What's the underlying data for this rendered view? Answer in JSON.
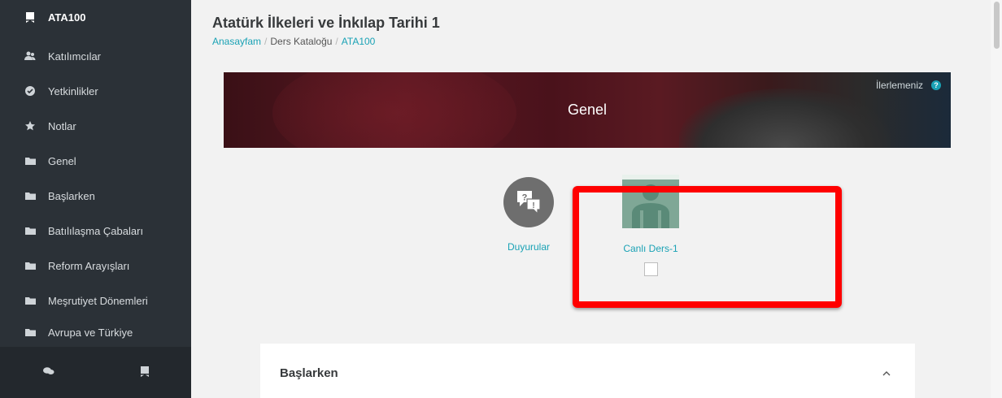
{
  "sidebar": {
    "items": [
      {
        "label": "ATA100",
        "icon": "course-book-icon"
      },
      {
        "label": "Katılımcılar",
        "icon": "users-icon"
      },
      {
        "label": "Yetkinlikler",
        "icon": "check-circle-icon"
      },
      {
        "label": "Notlar",
        "icon": "star-icon"
      },
      {
        "label": "Genel",
        "icon": "folder-icon"
      },
      {
        "label": "Başlarken",
        "icon": "folder-icon"
      },
      {
        "label": "Batılılaşma Çabaları",
        "icon": "folder-icon"
      },
      {
        "label": "Reform Arayışları",
        "icon": "folder-icon"
      },
      {
        "label": "Meşrutiyet Dönemleri",
        "icon": "folder-icon"
      },
      {
        "label": "Avrupa ve Türkiye",
        "icon": "folder-icon"
      }
    ],
    "footer_icons": [
      "chat-icon",
      "course-book-icon"
    ]
  },
  "header": {
    "title": "Atatürk İlkeleri ve İnkılap Tarihi 1",
    "breadcrumb": {
      "home": "Anasayfam",
      "catalog": "Ders Kataloğu",
      "course": "ATA100",
      "separator": "/"
    }
  },
  "banner": {
    "title": "Genel",
    "progress_label": "İlerlemeniz",
    "help_glyph": "?"
  },
  "activities": [
    {
      "label": "Duyurular",
      "icon": "forum-icon"
    },
    {
      "label": "Canlı Ders-1",
      "icon": "live-session-icon",
      "completion_checked": false
    }
  ],
  "section": {
    "title": "Başlarken"
  },
  "colors": {
    "accent": "#1aa2b5",
    "sidebar_bg": "#2b3137",
    "highlight": "#ff0000"
  }
}
